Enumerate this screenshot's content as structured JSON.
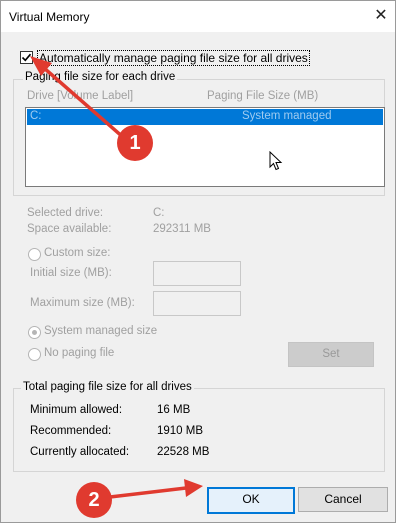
{
  "dialog": {
    "title": "Virtual Memory",
    "close_glyph": "✕"
  },
  "auto_manage": {
    "label": "Automatically manage paging file size for all drives",
    "checked": true
  },
  "paging_group": {
    "title": "Paging file size for each drive",
    "col_drive": "Drive  [Volume Label]",
    "col_size": "Paging File Size (MB)",
    "rows": [
      {
        "drive": "C:",
        "size": "System managed"
      }
    ]
  },
  "selected": {
    "drive_label": "Selected drive:",
    "drive_value": "C:",
    "space_label": "Space available:",
    "space_value": "292311 MB"
  },
  "options": {
    "custom_size": "Custom size:",
    "initial_size": "Initial size (MB):",
    "maximum_size": "Maximum size (MB):",
    "system_managed": "System managed size",
    "no_paging": "No paging file",
    "set_button": "Set"
  },
  "totals": {
    "title": "Total paging file size for all drives",
    "min_label": "Minimum allowed:",
    "min_value": "16 MB",
    "rec_label": "Recommended:",
    "rec_value": "1910 MB",
    "cur_label": "Currently allocated:",
    "cur_value": "22528 MB"
  },
  "buttons": {
    "ok": "OK",
    "cancel": "Cancel"
  },
  "annotations": {
    "marker_1": "1",
    "marker_2": "2",
    "color": "#e03a2f"
  },
  "colors": {
    "selection": "#0078d7"
  }
}
